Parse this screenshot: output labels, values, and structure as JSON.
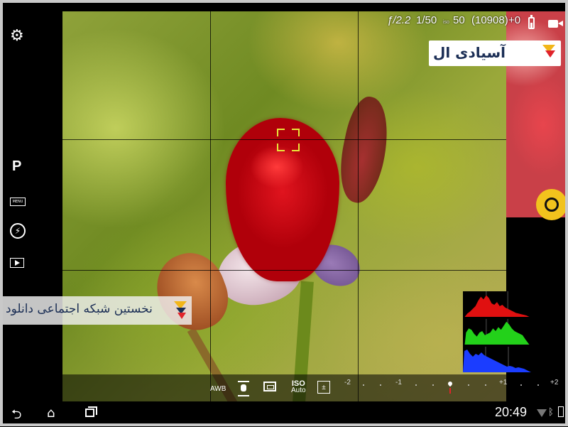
{
  "camera": {
    "mode": "P",
    "menu_label": "MENU",
    "aperture": "ƒ/2.2",
    "shutter": "1/50",
    "iso_small_label": "iso",
    "iso_value": "50",
    "shots_remaining": "(10908)",
    "ev_value": "+0"
  },
  "icons": {
    "settings": "gear-icon",
    "flash": "flash-auto-icon",
    "playback": "playback-icon",
    "battery": "battery-icon",
    "video": "video-camera-icon",
    "shutter": "shutter-icon"
  },
  "watermark": {
    "logo_text": "آسیادی ال",
    "banner_text": "نخستین شبکه اجتماعی دانلود",
    "colors": {
      "navy": "#1b2e55",
      "yellow": "#f2b619",
      "red": "#e0232b"
    }
  },
  "controls": {
    "awb": "AWB",
    "iso_title": "ISO",
    "iso_mode": "Auto",
    "ev_scale": [
      "-2",
      "-1",
      "+1",
      "+2"
    ]
  },
  "system": {
    "clock": "20:49"
  },
  "histogram": {
    "channels": [
      "red",
      "green",
      "blue"
    ],
    "colors": {
      "red": "#e01010",
      "green": "#23d11a",
      "blue": "#1b3dff"
    }
  },
  "accent": {
    "focus_box": "#e7e63a",
    "shutter_button": "#f2c31d"
  }
}
